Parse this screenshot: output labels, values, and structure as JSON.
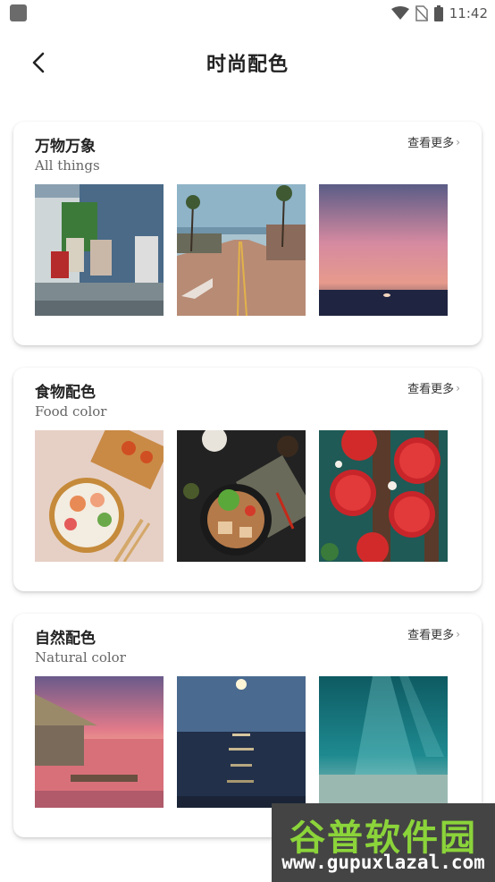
{
  "status_bar": {
    "time": "11:42",
    "icons": [
      "app-badge-icon",
      "wifi-icon",
      "no-sim-icon",
      "battery-icon"
    ]
  },
  "header": {
    "title": "时尚配色",
    "back_icon": "chevron-left-icon"
  },
  "sections": [
    {
      "title": "万物万象",
      "subtitle": "All things",
      "more_label": "查看更多",
      "images": [
        "street-shop-photo",
        "palm-road-photo",
        "pink-sunset-sky-photo"
      ]
    },
    {
      "title": "食物配色",
      "subtitle": "Food color",
      "more_label": "查看更多",
      "images": [
        "ramen-bowl-photo",
        "stir-fry-dish-photo",
        "strawberry-tarts-photo"
      ]
    },
    {
      "title": "自然配色",
      "subtitle": "Natural color",
      "more_label": "查看更多",
      "images": [
        "overwater-hut-sunset-photo",
        "moonlit-sea-photo",
        "underwater-light-photo"
      ]
    }
  ],
  "watermark": {
    "title": "谷普软件园",
    "url": "www.gupuxlazal.com"
  }
}
